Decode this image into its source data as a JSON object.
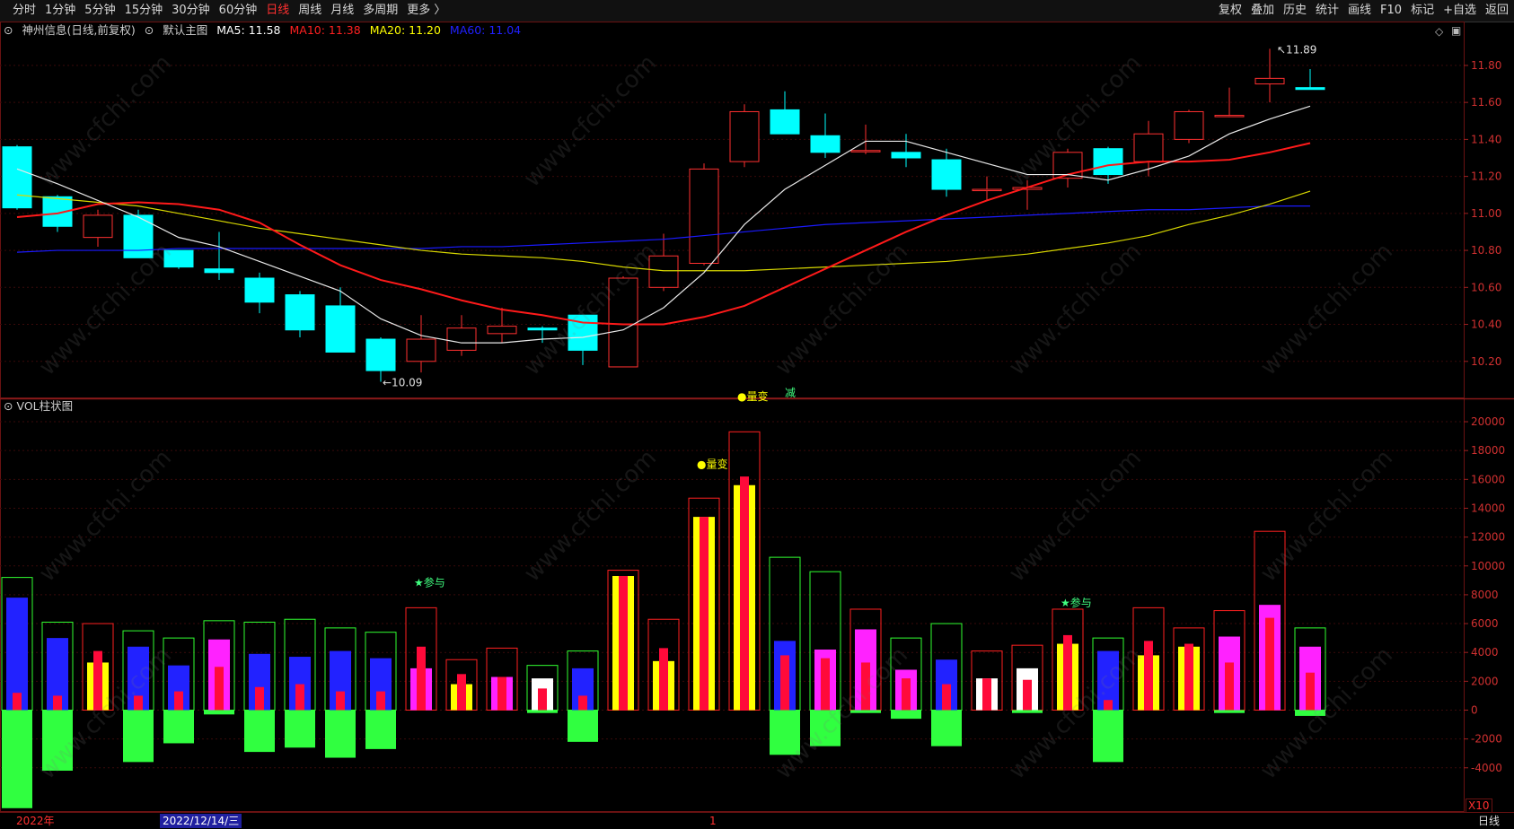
{
  "toolbar": {
    "left": [
      "分时",
      "1分钟",
      "5分钟",
      "15分钟",
      "30分钟",
      "60分钟",
      "日线",
      "周线",
      "月线",
      "多周期",
      "更多 〉"
    ],
    "active": "日线",
    "right": [
      "复权",
      "叠加",
      "历史",
      "统计",
      "画线",
      "F10",
      "标记",
      "+自选",
      "返回"
    ]
  },
  "main": {
    "stock": "神州信息(日线,前复权)",
    "template": "默认主图",
    "ma": [
      {
        "label": "MA5: 11.58",
        "color": "#ffffff"
      },
      {
        "label": "MA10: 11.38",
        "color": "#ff2020"
      },
      {
        "label": "MA20: 11.20",
        "color": "#ffff00"
      },
      {
        "label": "MA60: 11.04",
        "color": "#2020ff"
      }
    ],
    "high_label": "11.89",
    "low_label": "10.09",
    "marker_text": "减"
  },
  "price_axis": [
    "11.80",
    "11.60",
    "11.40",
    "11.20",
    "11.00",
    "10.80",
    "10.60",
    "10.40",
    "10.20"
  ],
  "volume": {
    "title": "VOL柱状图",
    "axis": [
      "20000",
      "18000",
      "16000",
      "14000",
      "12000",
      "10000",
      "8000",
      "6000",
      "4000",
      "2000",
      "0",
      "-2000",
      "-4000"
    ],
    "annotations": [
      {
        "text": "●量变",
        "color": "#ffff00"
      },
      {
        "text": "●量变",
        "color": "#ffff00"
      },
      {
        "text": "★参与",
        "color": "#40ff80"
      },
      {
        "text": "★参与",
        "color": "#40ff80"
      }
    ],
    "scale_label": "X10"
  },
  "bottom": {
    "year": "2022年",
    "selected_date": "2022/12/14/三",
    "month_mark": "1",
    "period": "日线"
  },
  "watermark": "www.cfchi.com",
  "chart_data": {
    "type": "candlestick",
    "candles": [
      {
        "o": 11.36,
        "h": 11.37,
        "l": 11.02,
        "c": 11.03
      },
      {
        "o": 11.09,
        "h": 11.1,
        "l": 10.9,
        "c": 10.93
      },
      {
        "o": 10.87,
        "h": 11.02,
        "l": 10.82,
        "c": 10.99
      },
      {
        "o": 10.99,
        "h": 11.02,
        "l": 10.76,
        "c": 10.76
      },
      {
        "o": 10.8,
        "h": 10.8,
        "l": 10.7,
        "c": 10.71
      },
      {
        "o": 10.7,
        "h": 10.9,
        "l": 10.64,
        "c": 10.68
      },
      {
        "o": 10.65,
        "h": 10.68,
        "l": 10.46,
        "c": 10.52
      },
      {
        "o": 10.56,
        "h": 10.58,
        "l": 10.33,
        "c": 10.37
      },
      {
        "o": 10.5,
        "h": 10.6,
        "l": 10.25,
        "c": 10.25
      },
      {
        "o": 10.32,
        "h": 10.33,
        "l": 10.09,
        "c": 10.15
      },
      {
        "o": 10.2,
        "h": 10.45,
        "l": 10.14,
        "c": 10.32
      },
      {
        "o": 10.26,
        "h": 10.45,
        "l": 10.23,
        "c": 10.38
      },
      {
        "o": 10.35,
        "h": 10.49,
        "l": 10.3,
        "c": 10.39
      },
      {
        "o": 10.38,
        "h": 10.39,
        "l": 10.3,
        "c": 10.37
      },
      {
        "o": 10.45,
        "h": 10.45,
        "l": 10.18,
        "c": 10.26
      },
      {
        "o": 10.17,
        "h": 10.66,
        "l": 10.17,
        "c": 10.65
      },
      {
        "o": 10.6,
        "h": 10.89,
        "l": 10.58,
        "c": 10.77
      },
      {
        "o": 10.73,
        "h": 11.27,
        "l": 10.72,
        "c": 11.24
      },
      {
        "o": 11.28,
        "h": 11.59,
        "l": 11.25,
        "c": 11.55
      },
      {
        "o": 11.56,
        "h": 11.66,
        "l": 11.43,
        "c": 11.43
      },
      {
        "o": 11.42,
        "h": 11.54,
        "l": 11.3,
        "c": 11.33
      },
      {
        "o": 11.34,
        "h": 11.48,
        "l": 11.32,
        "c": 11.34
      },
      {
        "o": 11.33,
        "h": 11.43,
        "l": 11.25,
        "c": 11.3
      },
      {
        "o": 11.29,
        "h": 11.35,
        "l": 11.09,
        "c": 11.13
      },
      {
        "o": 11.13,
        "h": 11.2,
        "l": 11.07,
        "c": 11.13
      },
      {
        "o": 11.13,
        "h": 11.18,
        "l": 11.02,
        "c": 11.14
      },
      {
        "o": 11.19,
        "h": 11.35,
        "l": 11.14,
        "c": 11.33
      },
      {
        "o": 11.35,
        "h": 11.36,
        "l": 11.16,
        "c": 11.21
      },
      {
        "o": 11.28,
        "h": 11.5,
        "l": 11.2,
        "c": 11.43
      },
      {
        "o": 11.4,
        "h": 11.56,
        "l": 11.38,
        "c": 11.55
      },
      {
        "o": 11.53,
        "h": 11.68,
        "l": 11.52,
        "c": 11.53
      },
      {
        "o": 11.7,
        "h": 11.89,
        "l": 11.6,
        "c": 11.73
      },
      {
        "o": 11.68,
        "h": 11.78,
        "l": 11.67,
        "c": 11.67
      }
    ],
    "ma5": [
      11.24,
      11.16,
      11.07,
      10.98,
      10.87,
      10.82,
      10.74,
      10.66,
      10.58,
      10.43,
      10.34,
      10.3,
      10.3,
      10.32,
      10.33,
      10.37,
      10.49,
      10.68,
      10.94,
      11.13,
      11.26,
      11.39,
      11.39,
      11.33,
      11.27,
      11.21,
      11.21,
      11.18,
      11.24,
      11.31,
      11.43,
      11.51,
      11.58
    ],
    "ma10": [
      10.98,
      11.0,
      11.05,
      11.06,
      11.05,
      11.02,
      10.95,
      10.83,
      10.72,
      10.64,
      10.59,
      10.53,
      10.48,
      10.45,
      10.41,
      10.4,
      10.4,
      10.44,
      10.5,
      10.6,
      10.7,
      10.8,
      10.9,
      10.99,
      11.07,
      11.14,
      11.21,
      11.26,
      11.28,
      11.28,
      11.29,
      11.33,
      11.38
    ],
    "ma20": [
      11.1,
      11.08,
      11.06,
      11.04,
      11.0,
      10.96,
      10.92,
      10.89,
      10.86,
      10.83,
      10.8,
      10.78,
      10.77,
      10.76,
      10.74,
      10.71,
      10.69,
      10.69,
      10.69,
      10.7,
      10.71,
      10.72,
      10.73,
      10.74,
      10.76,
      10.78,
      10.81,
      10.84,
      10.88,
      10.94,
      10.99,
      11.05,
      11.12
    ],
    "ma60": [
      10.79,
      10.8,
      10.8,
      10.8,
      10.81,
      10.81,
      10.81,
      10.81,
      10.81,
      10.81,
      10.81,
      10.82,
      10.82,
      10.83,
      10.84,
      10.85,
      10.86,
      10.88,
      10.9,
      10.92,
      10.94,
      10.95,
      10.96,
      10.97,
      10.98,
      10.99,
      11.0,
      11.01,
      11.02,
      11.02,
      11.03,
      11.04,
      11.04
    ],
    "vol_frame": [
      9200,
      6100,
      6000,
      5500,
      5000,
      6200,
      6100,
      6300,
      5700,
      5400,
      7100,
      3500,
      4300,
      3100,
      4100,
      9700,
      6300,
      14700,
      19300,
      10600,
      9600,
      7000,
      5000,
      6000,
      4100,
      4500,
      7000,
      5000,
      7100,
      5700,
      6900,
      12400,
      5700
    ],
    "vol_inner": [
      7800,
      5000,
      3300,
      4400,
      3100,
      4900,
      3900,
      3700,
      4100,
      3600,
      2900,
      1800,
      2300,
      2200,
      2900,
      9300,
      3400,
      13400,
      15600,
      4800,
      4200,
      5600,
      2800,
      3500,
      2200,
      2900,
      4600,
      4100,
      3800,
      4400,
      5100,
      7300,
      4400
    ],
    "vol_inner_color": [
      "#2222ff",
      "#2222ff",
      "#ffff00",
      "#2222ff",
      "#2222ff",
      "#ff22ff",
      "#2222ff",
      "#2222ff",
      "#2222ff",
      "#2222ff",
      "#ff22ff",
      "#ffff00",
      "#ff22ff",
      "#ffffff",
      "#2222ff",
      "#ffff00",
      "#ffff00",
      "#ffff00",
      "#ffff00",
      "#2222ff",
      "#ff22ff",
      "#ff22ff",
      "#ff22ff",
      "#2222ff",
      "#ffffff",
      "#ffffff",
      "#ffff00",
      "#2222ff",
      "#ffff00",
      "#ffff00",
      "#ff22ff",
      "#ff22ff",
      "#ff22ff"
    ],
    "vol_red": [
      1200,
      1000,
      4100,
      1000,
      1300,
      3000,
      1600,
      1800,
      1300,
      1300,
      4400,
      2500,
      2300,
      1500,
      1000,
      9300,
      4300,
      13400,
      16200,
      3800,
      3600,
      3300,
      2200,
      1800,
      2200,
      2100,
      5200,
      700,
      4800,
      4600,
      3300,
      6400,
      2600
    ],
    "vol_neg": [
      -6800,
      -4200,
      0,
      -3600,
      -2300,
      -300,
      -2900,
      -2600,
      -3300,
      -2700,
      0,
      0,
      0,
      -200,
      -2200,
      0,
      0,
      0,
      0,
      -3100,
      -2500,
      -200,
      -600,
      -2500,
      0,
      -200,
      0,
      -3600,
      0,
      0,
      -200,
      0,
      -400
    ],
    "price_range": [
      10.0,
      11.95
    ],
    "vol_range": [
      -7000,
      20500
    ]
  }
}
